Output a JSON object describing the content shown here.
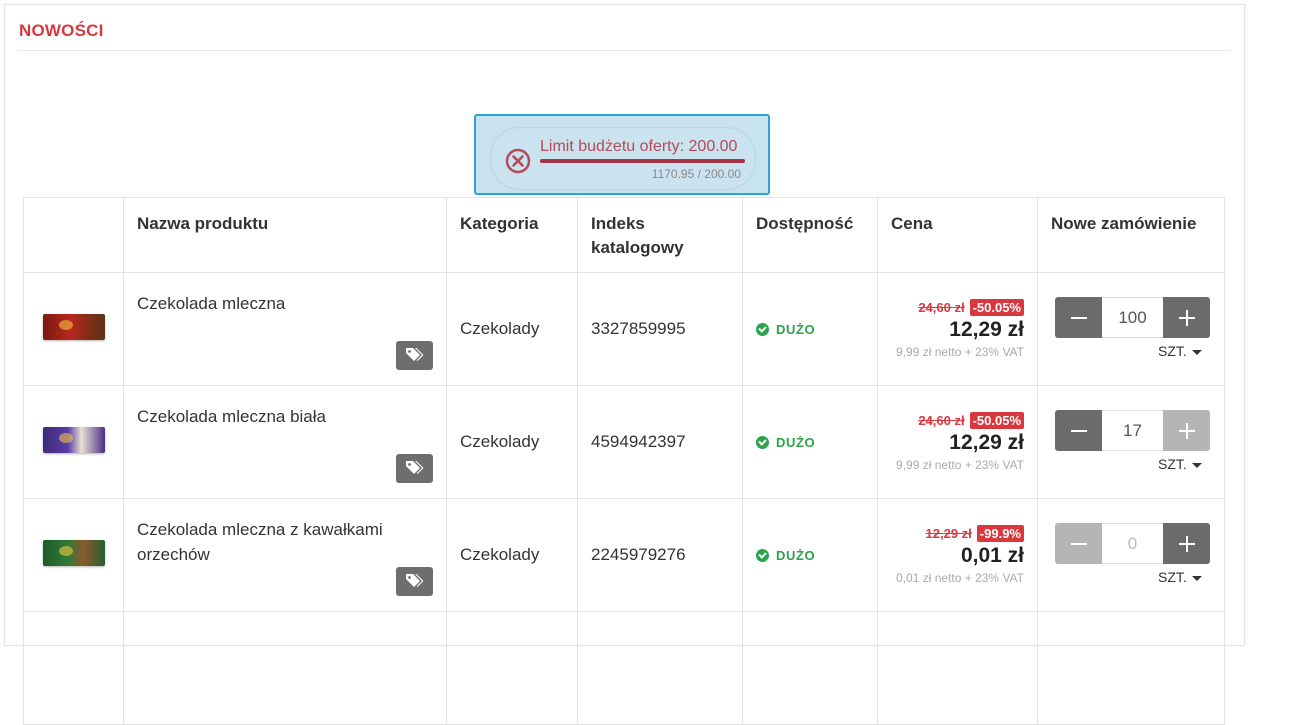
{
  "section": {
    "title": "NOWOŚCI"
  },
  "budget": {
    "label": "Limit budżetu oferty: 200.00",
    "values": "1170.95 / 200.00",
    "fill_fraction": 1.0,
    "icon": "close-circle-icon",
    "color": "#a23446"
  },
  "table": {
    "headers": {
      "image": "",
      "name": "Nazwa produktu",
      "category": "Kategoria",
      "index": "Indeks katalogowy",
      "availability": "Dostępność",
      "price": "Cena",
      "order": "Nowe zamówienie"
    },
    "rows": [
      {
        "name": "Czekolada mleczna",
        "category": "Czekolady",
        "index": "3327859995",
        "availability": "DUŻO",
        "old_price": "24,60 zł",
        "discount": "-50.05%",
        "price": "12,29 zł",
        "net": "9,99 zł netto + 23% VAT",
        "qty": "100",
        "unit": "SZT.",
        "image": "chocolate-bar-red"
      },
      {
        "name": "Czekolada mleczna biała",
        "category": "Czekolady",
        "index": "4594942397",
        "availability": "DUŻO",
        "old_price": "24,60 zł",
        "discount": "-50.05%",
        "price": "12,29 zł",
        "net": "9,99 zł netto + 23% VAT",
        "qty": "17",
        "unit": "SZT.",
        "image": "chocolate-bar-purple"
      },
      {
        "name": "Czekolada mleczna z kawałkami orzechów",
        "category": "Czekolady",
        "index": "2245979276",
        "availability": "DUŻO",
        "old_price": "12,29 zł",
        "discount": "-99.9%",
        "price": "0,01 zł",
        "net": "0,01 zł netto + 23% VAT",
        "qty": "0",
        "unit": "SZT.",
        "image": "chocolate-bar-green"
      }
    ]
  },
  "colors": {
    "accent_red": "#d9383f",
    "available_green": "#2ca34a",
    "tooltip_border": "#2ba3d8"
  }
}
